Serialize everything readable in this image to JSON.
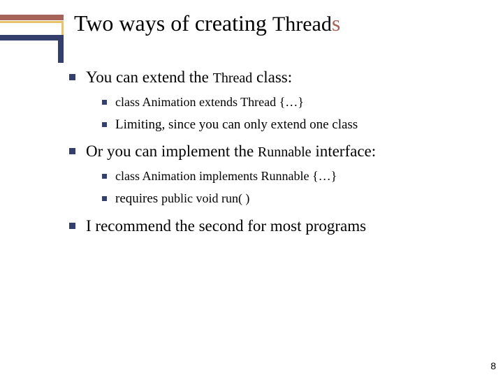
{
  "title": {
    "pre": "Two ways of creating ",
    "code": "Thread",
    "suffix": "s"
  },
  "bullets": {
    "b1": {
      "pre": "You can extend the ",
      "code": "Thread",
      "post": " class:",
      "s1": "class Animation extends Thread {…}",
      "s2": "Limiting, since you can only extend one class"
    },
    "b2": {
      "pre": "Or you can implement the ",
      "code": "Runnable",
      "post": " interface:",
      "s1": "class Animation implements Runnable {…}",
      "s2_pre": "requires ",
      "s2_code": "public void run( )"
    },
    "b3": "I recommend the second for most programs"
  },
  "page": "8"
}
